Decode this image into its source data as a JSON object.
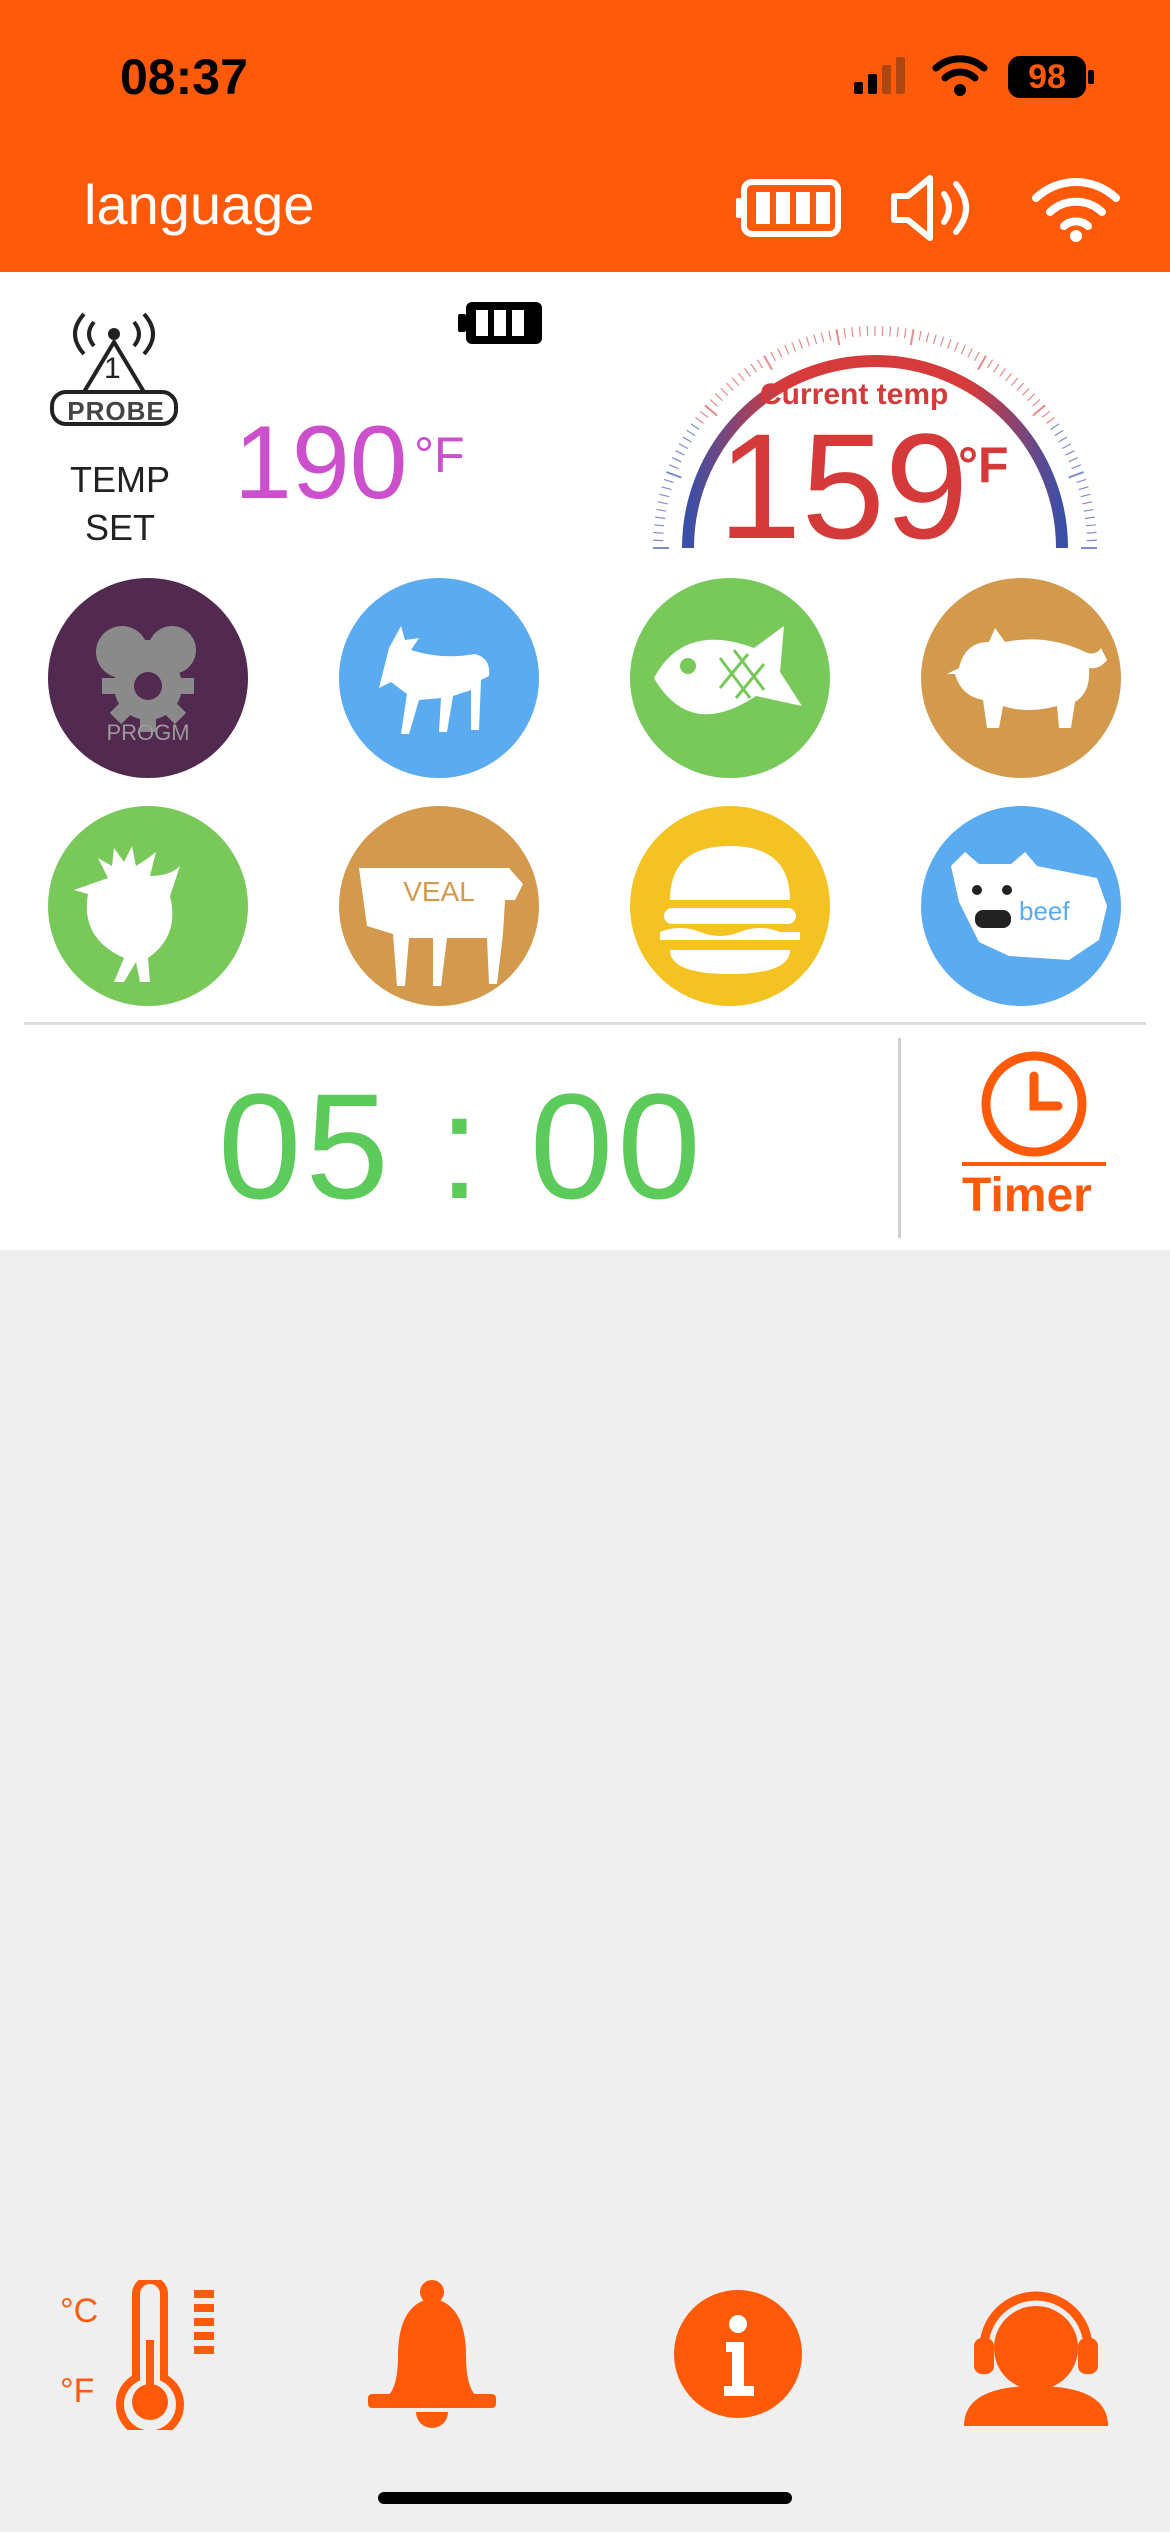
{
  "status_bar": {
    "time": "08:37",
    "battery": "98"
  },
  "header": {
    "language_label": "language"
  },
  "probe": {
    "badge_number": "1",
    "badge_text": "PROBE",
    "temp_set_label": "TEMP\nSET"
  },
  "set_temp": {
    "value": "190",
    "unit": "°F"
  },
  "current_temp": {
    "label": "Current temp",
    "value": "159",
    "unit": "°F"
  },
  "presets": [
    {
      "name": "PROGM"
    },
    {
      "name": "goat"
    },
    {
      "name": "fish"
    },
    {
      "name": "pig"
    },
    {
      "name": "chicken"
    },
    {
      "name": "VEAL"
    },
    {
      "name": "burger"
    },
    {
      "name": "beef"
    }
  ],
  "timer": {
    "value": "05 : 00",
    "label": "Timer"
  },
  "colors": {
    "accent": "#ff5a0a",
    "purple": "#52294f",
    "blue": "#5aabef",
    "green": "#78c85a",
    "tan": "#d39a4d",
    "yellow": "#f4c323",
    "set_temp": "#cc4fcc",
    "current_temp": "#d43a3a",
    "timer": "#5ccb5c"
  },
  "bottom_nav": [
    "thermometer-unit-icon",
    "bell-icon",
    "info-icon",
    "support-headset-icon"
  ]
}
